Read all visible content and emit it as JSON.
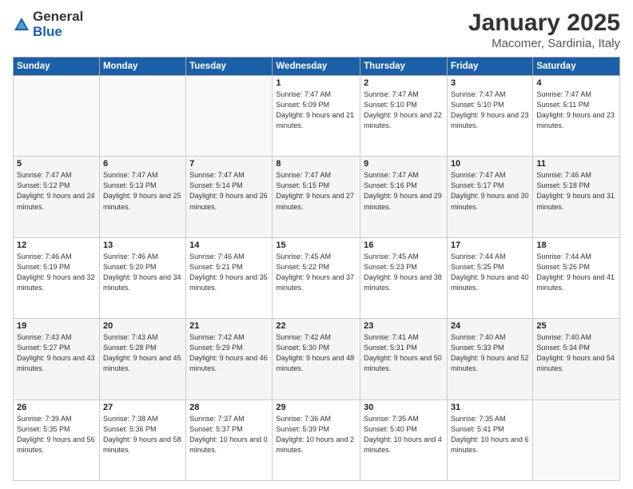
{
  "logo": {
    "general": "General",
    "blue": "Blue"
  },
  "title": "January 2025",
  "subtitle": "Macomer, Sardinia, Italy",
  "days_of_week": [
    "Sunday",
    "Monday",
    "Tuesday",
    "Wednesday",
    "Thursday",
    "Friday",
    "Saturday"
  ],
  "weeks": [
    [
      {
        "num": "",
        "info": ""
      },
      {
        "num": "",
        "info": ""
      },
      {
        "num": "",
        "info": ""
      },
      {
        "num": "1",
        "info": "Sunrise: 7:47 AM\nSunset: 5:09 PM\nDaylight: 9 hours and 21 minutes."
      },
      {
        "num": "2",
        "info": "Sunrise: 7:47 AM\nSunset: 5:10 PM\nDaylight: 9 hours and 22 minutes."
      },
      {
        "num": "3",
        "info": "Sunrise: 7:47 AM\nSunset: 5:10 PM\nDaylight: 9 hours and 23 minutes."
      },
      {
        "num": "4",
        "info": "Sunrise: 7:47 AM\nSunset: 5:11 PM\nDaylight: 9 hours and 23 minutes."
      }
    ],
    [
      {
        "num": "5",
        "info": "Sunrise: 7:47 AM\nSunset: 5:12 PM\nDaylight: 9 hours and 24 minutes."
      },
      {
        "num": "6",
        "info": "Sunrise: 7:47 AM\nSunset: 5:13 PM\nDaylight: 9 hours and 25 minutes."
      },
      {
        "num": "7",
        "info": "Sunrise: 7:47 AM\nSunset: 5:14 PM\nDaylight: 9 hours and 26 minutes."
      },
      {
        "num": "8",
        "info": "Sunrise: 7:47 AM\nSunset: 5:15 PM\nDaylight: 9 hours and 27 minutes."
      },
      {
        "num": "9",
        "info": "Sunrise: 7:47 AM\nSunset: 5:16 PM\nDaylight: 9 hours and 29 minutes."
      },
      {
        "num": "10",
        "info": "Sunrise: 7:47 AM\nSunset: 5:17 PM\nDaylight: 9 hours and 30 minutes."
      },
      {
        "num": "11",
        "info": "Sunrise: 7:46 AM\nSunset: 5:18 PM\nDaylight: 9 hours and 31 minutes."
      }
    ],
    [
      {
        "num": "12",
        "info": "Sunrise: 7:46 AM\nSunset: 5:19 PM\nDaylight: 9 hours and 32 minutes."
      },
      {
        "num": "13",
        "info": "Sunrise: 7:46 AM\nSunset: 5:20 PM\nDaylight: 9 hours and 34 minutes."
      },
      {
        "num": "14",
        "info": "Sunrise: 7:46 AM\nSunset: 5:21 PM\nDaylight: 9 hours and 35 minutes."
      },
      {
        "num": "15",
        "info": "Sunrise: 7:45 AM\nSunset: 5:22 PM\nDaylight: 9 hours and 37 minutes."
      },
      {
        "num": "16",
        "info": "Sunrise: 7:45 AM\nSunset: 5:23 PM\nDaylight: 9 hours and 38 minutes."
      },
      {
        "num": "17",
        "info": "Sunrise: 7:44 AM\nSunset: 5:25 PM\nDaylight: 9 hours and 40 minutes."
      },
      {
        "num": "18",
        "info": "Sunrise: 7:44 AM\nSunset: 5:26 PM\nDaylight: 9 hours and 41 minutes."
      }
    ],
    [
      {
        "num": "19",
        "info": "Sunrise: 7:43 AM\nSunset: 5:27 PM\nDaylight: 9 hours and 43 minutes."
      },
      {
        "num": "20",
        "info": "Sunrise: 7:43 AM\nSunset: 5:28 PM\nDaylight: 9 hours and 45 minutes."
      },
      {
        "num": "21",
        "info": "Sunrise: 7:42 AM\nSunset: 5:29 PM\nDaylight: 9 hours and 46 minutes."
      },
      {
        "num": "22",
        "info": "Sunrise: 7:42 AM\nSunset: 5:30 PM\nDaylight: 9 hours and 48 minutes."
      },
      {
        "num": "23",
        "info": "Sunrise: 7:41 AM\nSunset: 5:31 PM\nDaylight: 9 hours and 50 minutes."
      },
      {
        "num": "24",
        "info": "Sunrise: 7:40 AM\nSunset: 5:33 PM\nDaylight: 9 hours and 52 minutes."
      },
      {
        "num": "25",
        "info": "Sunrise: 7:40 AM\nSunset: 5:34 PM\nDaylight: 9 hours and 54 minutes."
      }
    ],
    [
      {
        "num": "26",
        "info": "Sunrise: 7:39 AM\nSunset: 5:35 PM\nDaylight: 9 hours and 56 minutes."
      },
      {
        "num": "27",
        "info": "Sunrise: 7:38 AM\nSunset: 5:36 PM\nDaylight: 9 hours and 58 minutes."
      },
      {
        "num": "28",
        "info": "Sunrise: 7:37 AM\nSunset: 5:37 PM\nDaylight: 10 hours and 0 minutes."
      },
      {
        "num": "29",
        "info": "Sunrise: 7:36 AM\nSunset: 5:39 PM\nDaylight: 10 hours and 2 minutes."
      },
      {
        "num": "30",
        "info": "Sunrise: 7:35 AM\nSunset: 5:40 PM\nDaylight: 10 hours and 4 minutes."
      },
      {
        "num": "31",
        "info": "Sunrise: 7:35 AM\nSunset: 5:41 PM\nDaylight: 10 hours and 6 minutes."
      },
      {
        "num": "",
        "info": ""
      }
    ]
  ]
}
